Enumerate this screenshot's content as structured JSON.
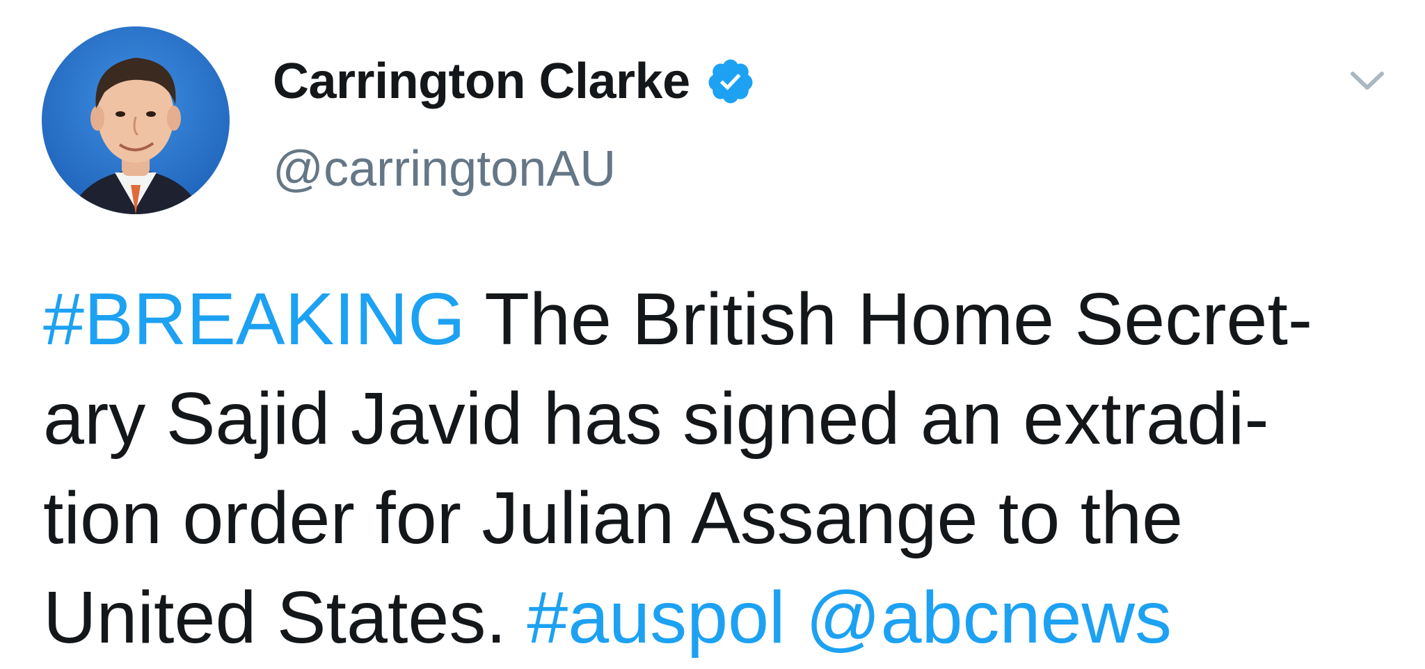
{
  "user": {
    "display_name": "Carrington Clarke",
    "handle": "@carringtonAU",
    "verified": true,
    "avatar_icon": "profile-photo"
  },
  "icons": {
    "verified": "verified-badge-icon",
    "menu": "chevron-down-icon"
  },
  "colors": {
    "link": "#1da1f2",
    "text": "#14171a",
    "secondary": "#657786",
    "verified_badge": "#1da1f2"
  },
  "tweet": {
    "hashtag_breaking": "#BREAKING",
    "line1_text": " The British Home Secret-",
    "line2_text": "ary Sajid Javid has signed an extradi-",
    "line3_text": "tion order for Julian Assange to the",
    "line4_text": "United States. ",
    "hashtag_auspol": "#auspol",
    "space": " ",
    "mention_abcnews": "@abcnews"
  }
}
